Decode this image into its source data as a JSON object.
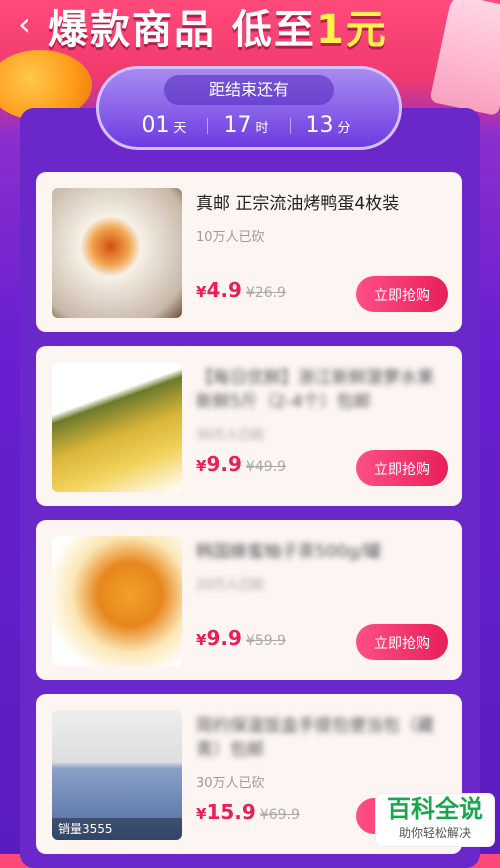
{
  "header": {
    "back_icon": "chevron-left-icon",
    "title_main": "爆款商品 低至",
    "title_accent": "1元"
  },
  "countdown": {
    "caption": "距结束还有",
    "days": "01",
    "days_unit": "天",
    "hours": "17",
    "hours_unit": "时",
    "minutes": "13",
    "minutes_unit": "分"
  },
  "products": [
    {
      "title": "真邮 正宗流油烤鸭蛋4枚装",
      "sold": "10万人已砍",
      "currency": "¥",
      "price": "4.9",
      "orig_price": "¥26.9",
      "buy_label": "立即抢购"
    },
    {
      "title": "【每日优鲜】浙江新鲜菠萝水果新鲜5斤（2-4个）包邮",
      "sold": "30万人已砍",
      "currency": "¥",
      "price": "9.9",
      "orig_price": "¥49.9",
      "buy_label": "立即抢购"
    },
    {
      "title": "韩国蜂蜜柚子茶500g/罐",
      "sold": "20万人已砍",
      "currency": "¥",
      "price": "9.9",
      "orig_price": "¥59.9",
      "buy_label": "立即抢购"
    },
    {
      "title": "简约保温饭盒手提包便当包（藏青）包邮",
      "sold": "30万人已砍",
      "currency": "¥",
      "price": "15.9",
      "orig_price": "¥69.9",
      "thumb_tag": "销量3555",
      "buy_label": "立即抢购"
    }
  ],
  "watermark": {
    "top": "百科全说",
    "sub": "助你轻松解决"
  }
}
